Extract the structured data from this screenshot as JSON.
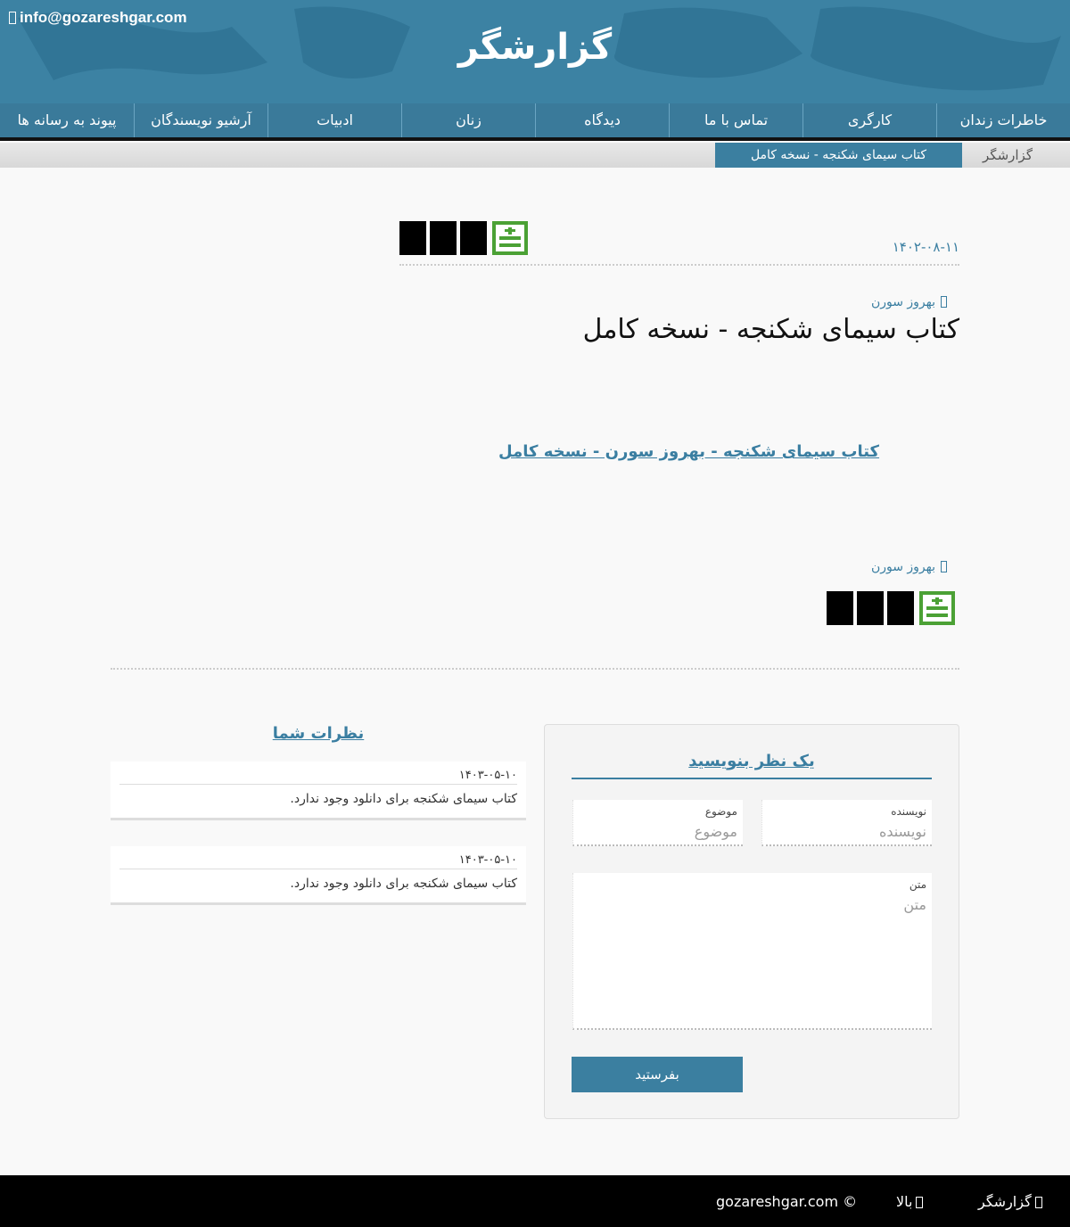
{
  "header": {
    "email": "info@gozareshgar.com",
    "site_title": "گزارشگر"
  },
  "nav": {
    "items": [
      {
        "label": "خاطرات زندان"
      },
      {
        "label": "کارگری"
      },
      {
        "label": "تماس با ما"
      },
      {
        "label": "دیدگاه"
      },
      {
        "label": "زنان"
      },
      {
        "label": "ادبیات"
      },
      {
        "label": "آرشیو نویسندگان"
      },
      {
        "label": "پیوند به رسانه ها"
      }
    ]
  },
  "breadcrumb": {
    "home": "گزارشگر",
    "current": "کتاب سیمای شکنجه - نسخه کامل"
  },
  "article": {
    "date": "۱۴۰۲-۰۸-۱۱",
    "author": "بهروز سورن",
    "title": "کتاب سیمای شکنجه - نسخه کامل",
    "link_text": "کتاب سیمای شکنجه - بهروز سورن - نسخه کامل",
    "author_bottom": "بهروز سورن"
  },
  "share": {
    "icons": [
      "share-icon",
      "share-icon",
      "share-icon",
      "add-share-icon"
    ],
    "glyph": ""
  },
  "form": {
    "title": "یک نظر بنویسید",
    "author_label": "نویسنده",
    "author_placeholder": "نویسنده",
    "subject_label": "موضوع",
    "subject_placeholder": "موضوع",
    "text_label": "متن",
    "text_placeholder": "متن",
    "submit": "بفرستید"
  },
  "comments": {
    "title": "نظرات شما",
    "items": [
      {
        "date": "۱۴۰۳-۰۵-۱۰",
        "text": "کتاب سیمای شکنجه برای دانلود وجود ندارد."
      },
      {
        "date": "۱۴۰۳-۰۵-۱۰",
        "text": "کتاب سیمای شکنجه برای دانلود وجود ندارد."
      }
    ]
  },
  "footer": {
    "copyright": "gozareshgar.com ©",
    "top": "بالا",
    "home": "گزارشگر"
  },
  "colors": {
    "brand": "#3c82a3",
    "share_green": "#4ba135",
    "link": "#3a7ea1"
  }
}
